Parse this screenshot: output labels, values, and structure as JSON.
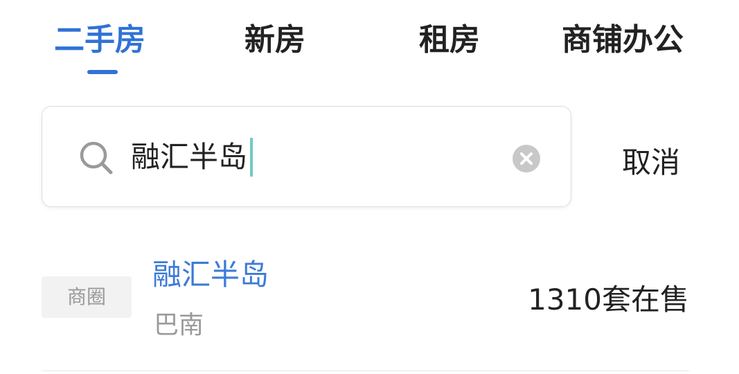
{
  "tabs": [
    {
      "label": "二手房",
      "active": true
    },
    {
      "label": "新房",
      "active": false
    },
    {
      "label": "租房",
      "active": false
    },
    {
      "label": "商铺办公",
      "active": false
    }
  ],
  "search": {
    "value": "融汇半岛",
    "icon": "search-icon",
    "clear_icon": "clear-icon"
  },
  "cancel_label": "取消",
  "results": [
    {
      "tag": "商圈",
      "title": "融汇半岛",
      "subtitle": "巴南",
      "count": "1310套在售"
    }
  ],
  "colors": {
    "accent": "#3072d6",
    "link": "#3c7bd8",
    "caret": "#72c9c2",
    "muted": "#9a9a9a"
  }
}
